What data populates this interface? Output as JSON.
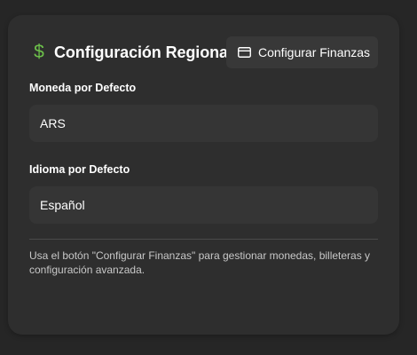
{
  "header": {
    "icon": "dollar-icon",
    "icon_color": "#6cc04a",
    "title": "Configuración Regional",
    "config_button": {
      "icon": "credit-card-icon",
      "label": "Configurar Finanzas"
    }
  },
  "fields": {
    "currency": {
      "label": "Moneda por Defecto",
      "value": "ARS"
    },
    "language": {
      "label": "Idioma por Defecto",
      "value": "Español"
    }
  },
  "help_text": "Usa el botón \"Configurar Finanzas\" para gestionar monedas, billeteras y configuración avanzada."
}
